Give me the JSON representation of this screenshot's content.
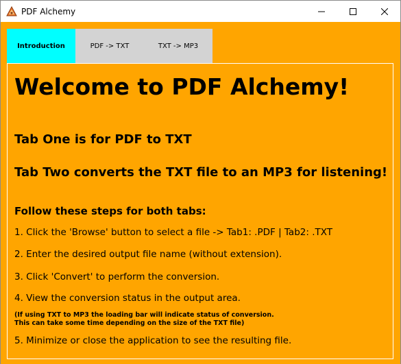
{
  "window": {
    "title": "PDF Alchemy",
    "icon": "pdf-alchemy-app-icon",
    "controls": [
      "minimize-icon",
      "maximize-icon",
      "close-icon"
    ]
  },
  "tabs": [
    {
      "label": "Introduction",
      "selected": true
    },
    {
      "label": "PDF -> TXT",
      "selected": false
    },
    {
      "label": "TXT -> MP3",
      "selected": false
    }
  ],
  "intro": {
    "heading": "Welcome to PDF Alchemy!",
    "tab_one": "Tab One is for PDF to TXT",
    "tab_two": "Tab Two converts the TXT file to an MP3 for listening!",
    "steps_heading": "Follow these steps for both tabs:",
    "steps": [
      "1. Click the 'Browse' button to select a file -> Tab1: .PDF | Tab2: .TXT",
      "2. Enter the desired output file name (without extension).",
      "3. Click 'Convert' to perform the conversion.",
      "4. View the conversion status in the output area.",
      "5. Minimize or close the application to see the resulting file."
    ],
    "note_line1": "(If using TXT to MP3 the loading bar will indicate status of conversion.",
    "note_line2": "This can take some time depending on the size of the TXT file)"
  },
  "colors": {
    "background": "#ffa500",
    "active_tab": "#00ffff",
    "inactive_tab": "#d3d3d3",
    "titlebar": "#ffffff"
  }
}
